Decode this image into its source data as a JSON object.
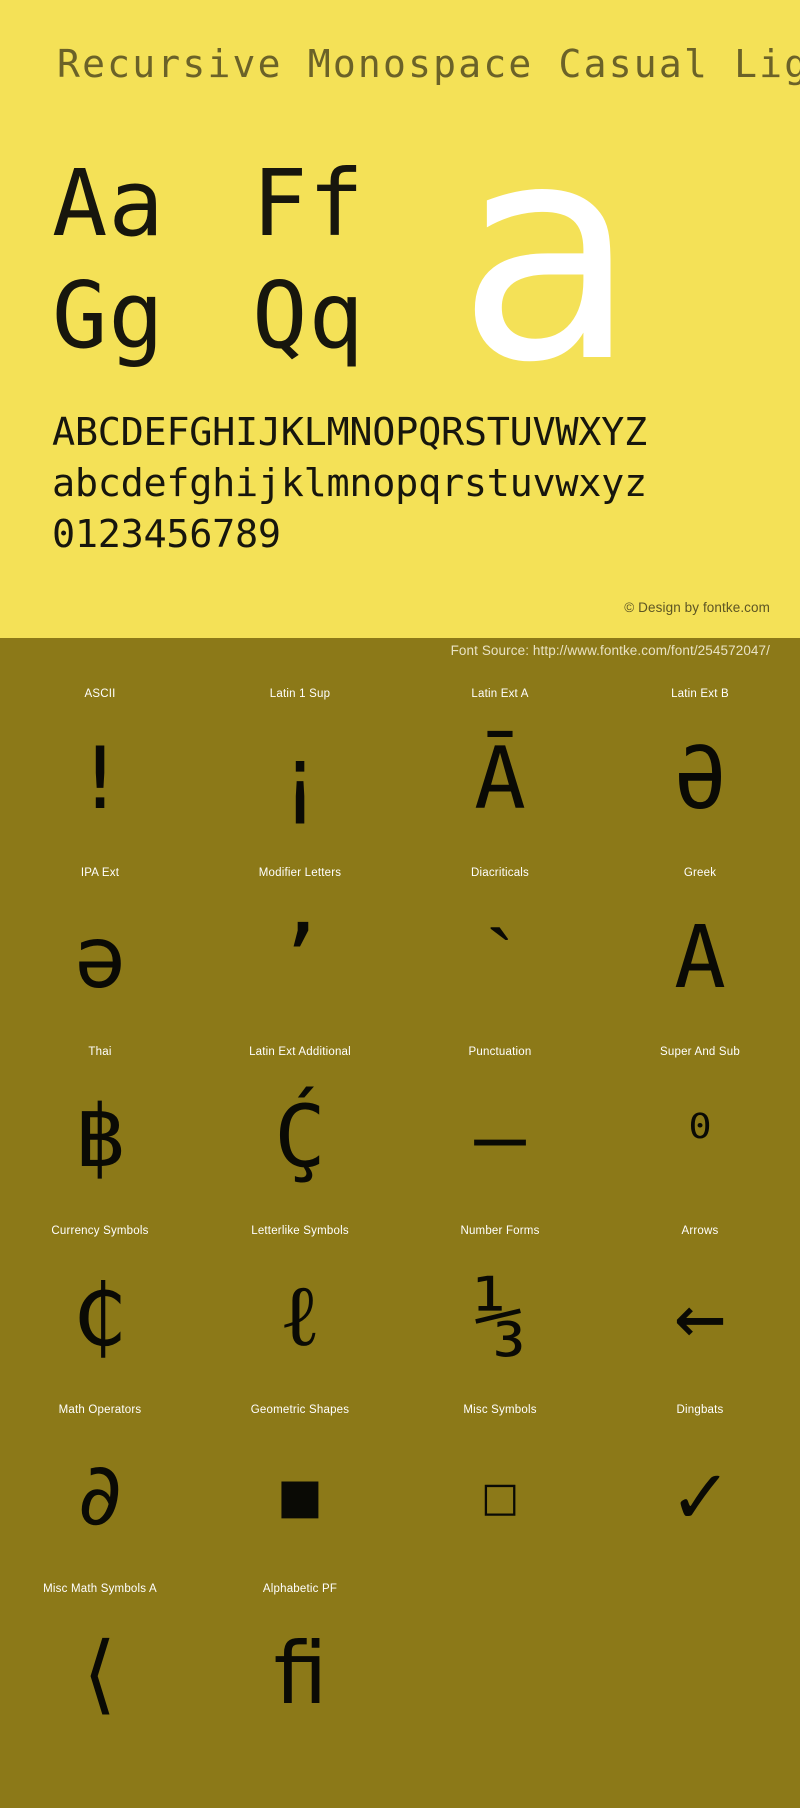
{
  "hero": {
    "title": "Recursive Monospace Casual Light",
    "pair_rows": [
      [
        "Aa",
        "Ff"
      ],
      [
        "Gg",
        "Qq"
      ]
    ],
    "watermark_glyph": "a",
    "alphabet_lines": [
      "ABCDEFGHIJKLMNOPQRSTUVWXYZ",
      "abcdefghijklmnopqrstuvwxyz",
      "0123456789"
    ],
    "copyright": "© Design by fontke.com",
    "background_color": "#f4e157",
    "title_color": "#6b6228",
    "watermark_color": "#ffffff"
  },
  "source": {
    "text": "Font Source: http://www.fontke.com/font/254572047/",
    "background_color": "#8c7918",
    "text_color": "#e9e2c4"
  },
  "blocks": {
    "rows": [
      [
        {
          "label": "ASCII",
          "glyph": "!",
          "size": "normal"
        },
        {
          "label": "Latin 1 Sup",
          "glyph": "¡",
          "size": "normal"
        },
        {
          "label": "Latin Ext A",
          "glyph": "Ā",
          "size": "normal"
        },
        {
          "label": "Latin Ext B",
          "glyph": "Ə",
          "size": "normal"
        }
      ],
      [
        {
          "label": "IPA Ext",
          "glyph": "ə",
          "size": "normal"
        },
        {
          "label": "Modifier Letters",
          "glyph": "ʼ",
          "size": "normal"
        },
        {
          "label": "Diacriticals",
          "glyph": "ˋ",
          "size": "normal"
        },
        {
          "label": "Greek",
          "glyph": "Α",
          "size": "normal"
        }
      ],
      [
        {
          "label": "Thai",
          "glyph": "฿",
          "size": "normal"
        },
        {
          "label": "Latin Ext Additional",
          "glyph": "Ḉ",
          "size": "normal"
        },
        {
          "label": "Punctuation",
          "glyph": "–",
          "size": "normal"
        },
        {
          "label": "Super And Sub",
          "glyph": "⁰",
          "size": "small"
        }
      ],
      [
        {
          "label": "Currency Symbols",
          "glyph": "₵",
          "size": "normal"
        },
        {
          "label": "Letterlike Symbols",
          "glyph": "ℓ",
          "size": "normal"
        },
        {
          "label": "Number Forms",
          "glyph": "⅓",
          "size": "normal"
        },
        {
          "label": "Arrows",
          "glyph": "←",
          "size": "normal"
        }
      ],
      [
        {
          "label": "Math Operators",
          "glyph": "∂",
          "size": "normal"
        },
        {
          "label": "Geometric Shapes",
          "glyph": "■",
          "size": "small"
        },
        {
          "label": "Misc Symbols",
          "glyph": "☐",
          "size": "small"
        },
        {
          "label": "Dingbats",
          "glyph": "✓",
          "size": "normal"
        }
      ],
      [
        {
          "label": "Misc Math Symbols A",
          "glyph": "⟨",
          "size": "normal"
        },
        {
          "label": "Alphabetic PF",
          "glyph": "ﬁ",
          "size": "normal"
        },
        {
          "label": "",
          "glyph": "",
          "size": "normal"
        },
        {
          "label": "",
          "glyph": "",
          "size": "normal"
        }
      ]
    ],
    "background_color": "#8c7918",
    "label_color": "#ffffff",
    "glyph_color": "#0a0a05"
  }
}
